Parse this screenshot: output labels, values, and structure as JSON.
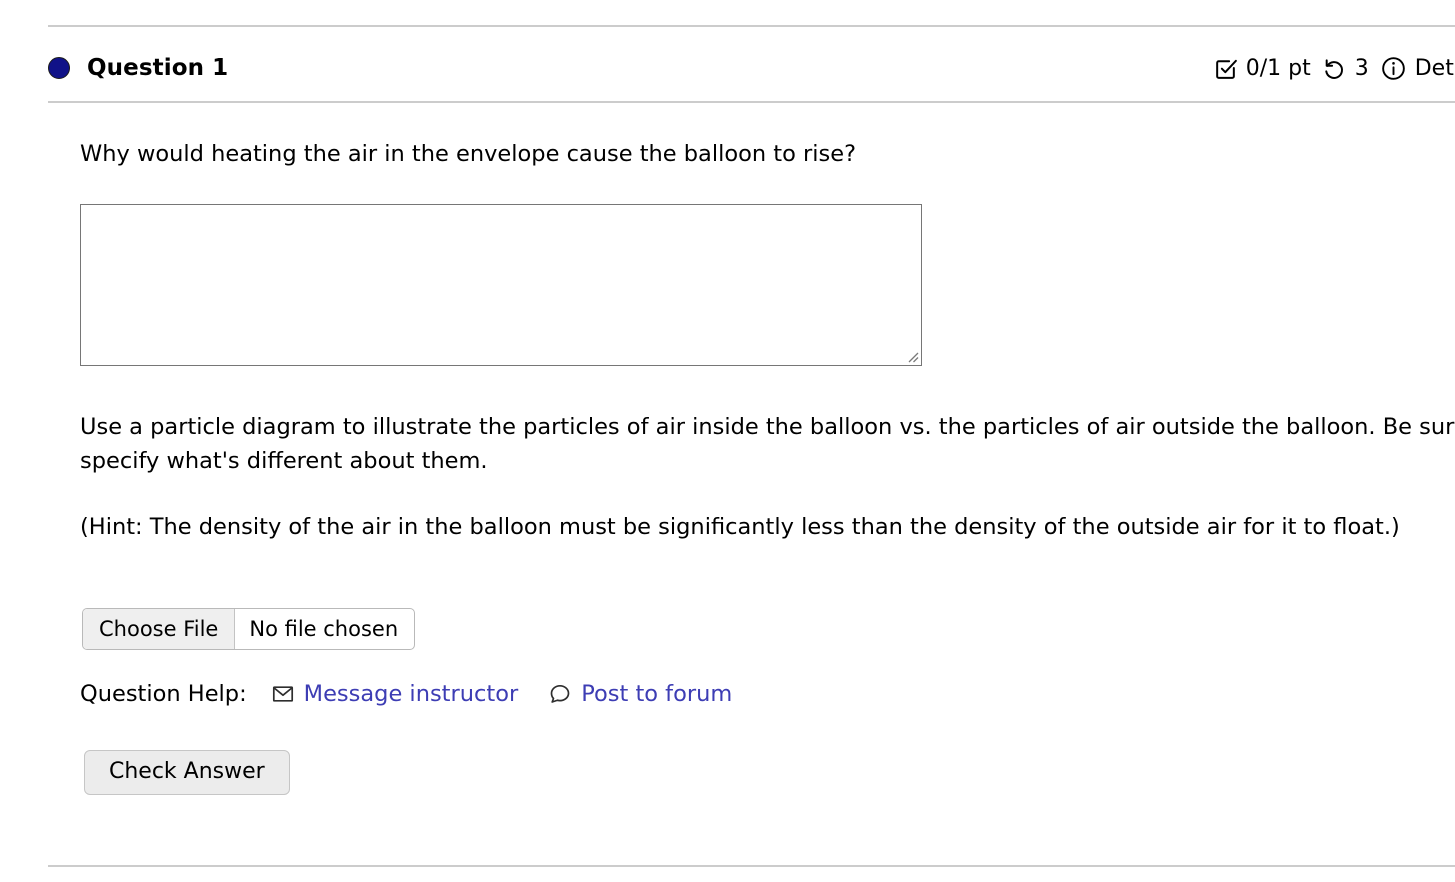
{
  "question": {
    "bullet_color": "#101288",
    "title": "Question 1",
    "score": "0/1 pt",
    "attempts": "3",
    "details_label": "Details",
    "icons": {
      "score": "checkbox-check-icon",
      "attempts": "rotate-counterclockwise-icon",
      "details": "info-circle-icon"
    }
  },
  "body": {
    "prompt": "Why would heating the air in the envelope cause the balloon to rise?",
    "answer_value": "",
    "answer_placeholder": "",
    "instructions": "Use a particle diagram to illustrate the particles of air inside the balloon vs. the particles of air outside the balloon. Be sure to specify what's different about them.",
    "hint": "(Hint: The density of the air in the balloon must be significantly less than the density of the outside air for it to float.)"
  },
  "file_upload": {
    "button_label": "Choose File",
    "status_text": "No file chosen"
  },
  "help": {
    "label": "Question Help:",
    "links": [
      {
        "label": "Message instructor",
        "icon": "envelope-icon",
        "color": "#3d3db4"
      },
      {
        "label": "Post to forum",
        "icon": "speech-bubble-icon",
        "color": "#3d3db4"
      }
    ]
  },
  "actions": {
    "check_answer_label": "Check Answer"
  }
}
